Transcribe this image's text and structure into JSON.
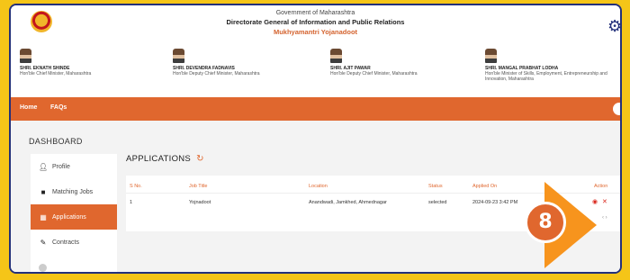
{
  "header": {
    "line1": "Government of Maharashtra",
    "line2": "Directorate General of Information and Public Relations",
    "line3": "Mukhyamantri Yojanadoot"
  },
  "leaders": [
    {
      "name": "SHRI. EKNATH SHINDE",
      "role": "Hon'ble Chief Minister, Maharashtra"
    },
    {
      "name": "SHRI. DEVENDRA FADNAVIS",
      "role": "Hon'ble Deputy Chief Minister, Maharashtra"
    },
    {
      "name": "SHRI. AJIT PAWAR",
      "role": "Hon'ble Deputy Chief Minister, Maharashtra"
    },
    {
      "name": "SHRI. MANGAL PRABHAT LODHA",
      "role": "Hon'ble Minister of Skills, Employment, Entrepreneurship and Innovation, Maharashtra"
    }
  ],
  "nav": {
    "home": "Home",
    "faqs": "FAQs"
  },
  "dashboard": {
    "title": "DASHBOARD"
  },
  "sidebar": {
    "items": [
      {
        "label": "Profile",
        "icon": "user-icon"
      },
      {
        "label": "Matching Jobs",
        "icon": "briefcase-icon"
      },
      {
        "label": "Applications",
        "icon": "grid-icon"
      },
      {
        "label": "Contracts",
        "icon": "pen-icon"
      }
    ]
  },
  "applications": {
    "title": "APPLICATIONS",
    "columns": [
      "S No.",
      "Job Title",
      "Location",
      "Status",
      "Applied On",
      "Action"
    ],
    "rows": [
      {
        "sno": "1",
        "job_title": "Yojnadoot",
        "location": "Anandwadi, Jamkhed, Ahmednagar",
        "status": "selected",
        "applied_on": "2024-09-23 3:42 PM"
      }
    ],
    "pager": "‹  ›"
  },
  "badge": {
    "number": "8"
  },
  "colors": {
    "accent": "#e0672e",
    "frame": "#23307a",
    "background": "#f5c518",
    "arrow": "#f7941d"
  }
}
